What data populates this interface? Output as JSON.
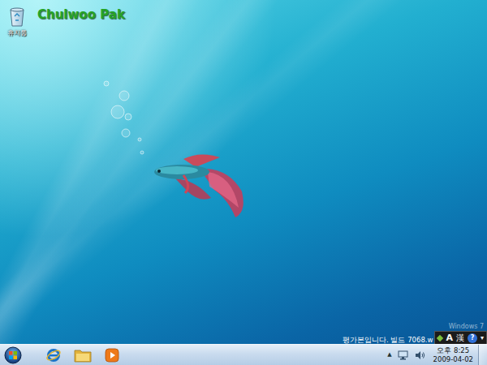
{
  "desktop": {
    "user_name": "Chulwoo Pak",
    "icons": [
      {
        "label": "휴지통",
        "selected": false
      }
    ]
  },
  "watermark": {
    "product": "Windows 7",
    "build_notice": "평가본입니다. 빌드 7068.w"
  },
  "language_bar": {
    "mode": "A",
    "hanja": "漢",
    "help": "?",
    "menu": "▾"
  },
  "tray": {
    "overflow": "▲",
    "time": "오후 8:25",
    "date": "2009-04-02"
  }
}
